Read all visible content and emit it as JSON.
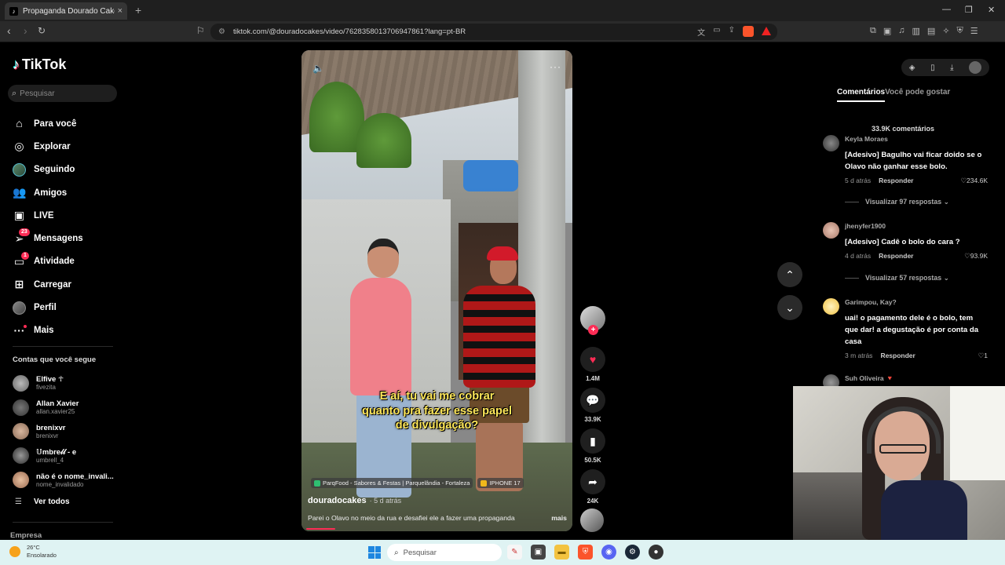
{
  "browser": {
    "tab_title": "Propaganda Dourado Cakes",
    "tab_close": "×",
    "new_tab": "+",
    "url": "tiktok.com/@douradocakes/video/7628358013706947861?lang=pt-BR"
  },
  "sidebar": {
    "logo": "TikTok",
    "search_placeholder": "Pesquisar",
    "nav": [
      {
        "label": "Para você",
        "icon": "home-icon"
      },
      {
        "label": "Explorar",
        "icon": "compass-icon"
      },
      {
        "label": "Seguindo",
        "icon": "following-avatar-icon"
      },
      {
        "label": "Amigos",
        "icon": "friends-icon"
      },
      {
        "label": "LIVE",
        "icon": "live-icon"
      },
      {
        "label": "Mensagens",
        "icon": "messages-icon",
        "badge": "23"
      },
      {
        "label": "Atividade",
        "icon": "activity-icon",
        "badge": "1"
      },
      {
        "label": "Carregar",
        "icon": "upload-icon"
      },
      {
        "label": "Perfil",
        "icon": "profile-avatar-icon"
      },
      {
        "label": "Mais",
        "icon": "more-icon"
      }
    ],
    "following_title": "Contas que você segue",
    "following": [
      {
        "name": "Elfive ☥",
        "handle": "fivezita"
      },
      {
        "name": "Allan Xavier",
        "handle": "allan.xavier25"
      },
      {
        "name": "brenixvr",
        "handle": "brenixvr"
      },
      {
        "name": "𝕌mbre𝓁𝓁 - e",
        "handle": "umbrell_4"
      },
      {
        "name": "não é o nome_invali...",
        "handle": "nome_invalidado"
      }
    ],
    "see_all": "Ver todos",
    "footer": "Empresa"
  },
  "video": {
    "caption_lines": [
      "E aí, tu vai me cobrar",
      "quanto pra fazer esse papel",
      "de divulgação?"
    ],
    "chips": [
      "ParqFood - Sabores & Festas | Parquelândia - Fortaleza",
      "IPHONE 17"
    ],
    "author": "douradocakes",
    "time": "· 5 d atrás",
    "description": "Parei o Olavo no meio da rua e desafiei ele a fazer uma propaganda",
    "more": "mais",
    "progress": 0.11
  },
  "actions": {
    "likes": "1.4M",
    "comments": "33.9K",
    "saves": "50.5K",
    "shares": "24K"
  },
  "comments_panel": {
    "tab_comments": "Comentários",
    "tab_suggested": "Você pode gostar",
    "count": "33.9K comentários",
    "items": [
      {
        "user": "Keyla Moraes",
        "text": "[Adesivo] Bagulho vai ficar doido se o Olavo não ganhar esse bolo.",
        "time": "5 d atrás",
        "reply": "Responder",
        "likes": "♡234.6K",
        "replies": "Visualizar 97 respostas ⌄"
      },
      {
        "user": "jhenyfer1900",
        "text": "[Adesivo] Cadê o bolo do cara ?",
        "time": "4 d atrás",
        "reply": "Responder",
        "likes": "♡93.9K",
        "replies": "Visualizar 57 respostas ⌄"
      },
      {
        "user": "Garimpou, Kay?",
        "text": "uai! o pagamento dele é o bolo, tem que dar! a degustação é por conta da casa",
        "time": "3 m atrás",
        "reply": "Responder",
        "likes": "♡1"
      },
      {
        "user": "Suh Oliveira 🔻"
      }
    ]
  },
  "taskbar": {
    "temp": "26°C",
    "weather": "Ensolarado",
    "search_placeholder": "Pesquisar"
  }
}
